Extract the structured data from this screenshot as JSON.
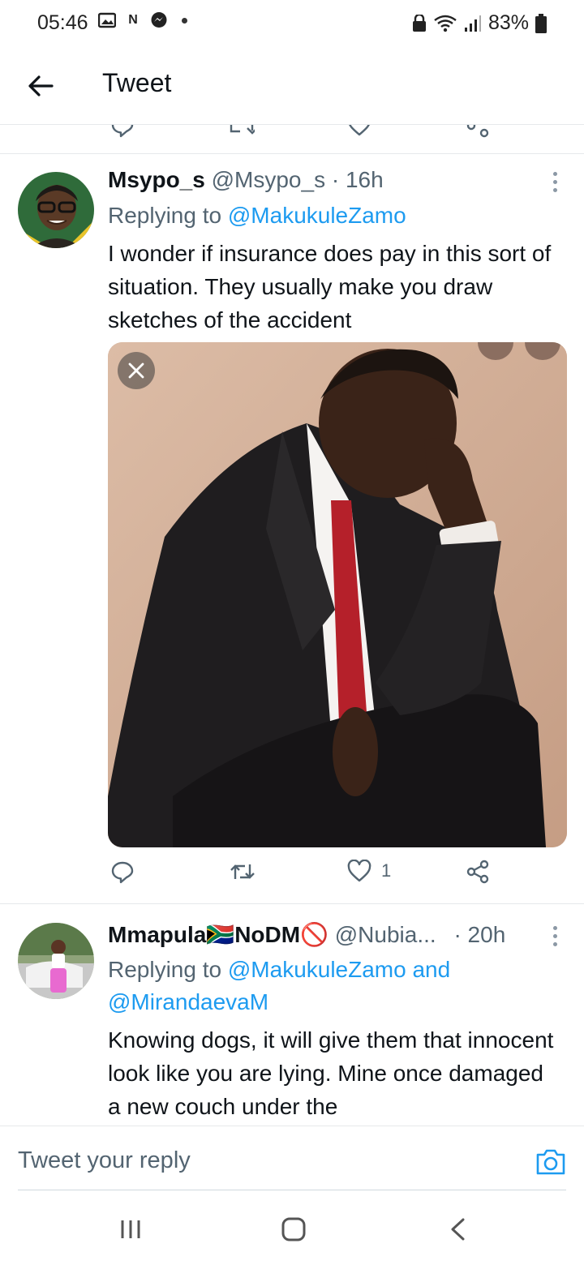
{
  "status_bar": {
    "time": "05:46",
    "notif_n": "N",
    "battery": "83%"
  },
  "header": {
    "title": "Tweet"
  },
  "tweets": [
    {
      "name": "Msypo_s",
      "handle": "@Msypo_s",
      "separator": "·",
      "time": "16h",
      "replying_prefix": "Replying to",
      "replying_to": "@MakukuleZamo",
      "text": "I wonder if insurance does pay in this sort of situation. They usually make you draw sketches of the accident",
      "likes": "1",
      "has_media": true
    },
    {
      "name": "Mmapula🇿🇦NoDM🚫",
      "handle": "@Nubia...",
      "separator": "·",
      "time": "20h",
      "replying_prefix": "Replying to",
      "replying_to": "@MakukuleZamo and @MirandaevaM",
      "text": "Knowing dogs, it will give them that innocent look like you are lying. Mine once damaged a new couch under the"
    }
  ],
  "composer": {
    "placeholder": "Tweet your reply"
  },
  "colors": {
    "accent": "#1d9bf0",
    "secondary_text": "#536471",
    "divider": "#e6e9eb"
  }
}
